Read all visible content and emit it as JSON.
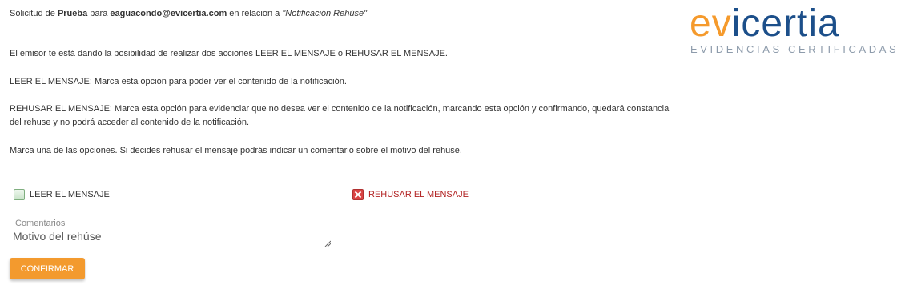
{
  "header": {
    "prefix": "Solicitud de",
    "sender": "Prueba",
    "mid": "para",
    "email": "eaguacondo@evicertia.com",
    "relation": "en relacion a",
    "subject": "\"Notificación Rehúse\""
  },
  "logo": {
    "ev": "ev",
    "rest": "icertia",
    "tagline": "EVIDENCIAS CERTIFICADAS"
  },
  "text": {
    "intro": "El emisor te está dando la posibilidad de realizar dos acciones LEER EL MENSAJE o REHUSAR EL MENSAJE.",
    "read_desc": "LEER EL MENSAJE: Marca esta opción para poder ver el contenido de la notificación.",
    "refuse_desc_1": "REHUSAR EL MENSAJE: Marca esta opción para evidenciar que no desea ver el contenido de la notificación, marcando esta opción y confirmando, quedará constancia",
    "refuse_desc_2": "del rehuse y no podrá acceder al contenido de la notificación.",
    "instruction": "Marca una de las opciones. Si decides rehusar el mensaje podrás indicar un comentario sobre el motivo del rehuse."
  },
  "options": {
    "read_label": "LEER EL MENSAJE",
    "refuse_label": "REHUSAR EL MENSAJE"
  },
  "comment": {
    "label": "Comentarios",
    "placeholder": "Motivo del rehúse"
  },
  "confirm_label": "CONFIRMAR",
  "colors": {
    "accent": "#f39a2e",
    "brand_blue": "#1c4f8a",
    "refuse_red": "#b22222"
  }
}
